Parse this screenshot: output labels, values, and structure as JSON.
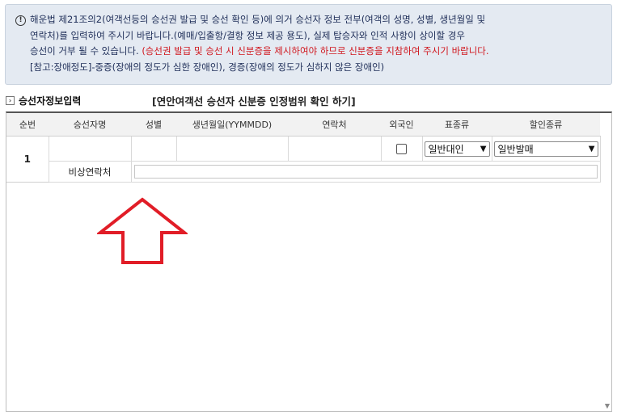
{
  "notice": {
    "line1": "해운법 제21조의2(여객선등의 승선권 발급 및 승선 확인 등)에 의거 승선자 정보 전부(여객의 성명, 성별, 생년월일 및",
    "line2": "연락처)를 입력하여 주시기 바랍니다.(예매/입출항/결항 정보 제공 용도), 실제 탑승자와 인적 사항이 상이할 경우",
    "line3_normal": "승선이 거부 될 수 있습니다. ",
    "line3_red": "(승선권 발급 및 승선 시 신분증을 제시하여야 하므로 신분증을 지참하여 주시기 바랍니다.",
    "line4": "[참고:장애정도]-중증(장애의 정도가 심한 장애인), 경증(장애의 정도가 심하지 않은 장애인)"
  },
  "section": {
    "title": "승선자정보입력",
    "id_link": "[연안여객선 승선자 신분증 인정범위 확인 하기]"
  },
  "table": {
    "headers": [
      "순번",
      "승선자명",
      "성별",
      "생년월일(YYMMDD)",
      "연락처",
      "외국인",
      "표종류",
      "할인종류"
    ],
    "row1": {
      "seq": "1",
      "name": "",
      "gender": "",
      "birth": "",
      "phone": "",
      "foreigner": false,
      "ticket_type": "일반대인",
      "discount_type": "일반발매",
      "emergency_label": "비상연락처",
      "emergency_value": ""
    }
  },
  "colors": {
    "notice_bg": "#e4eaf2",
    "notice_text": "#21305a",
    "warning_red": "#d0161d",
    "arrow_red": "#e11d27"
  },
  "icons": [
    "warning-icon",
    "section-arrow-icon",
    "chevron-down-icon",
    "up-arrow-annotation"
  ]
}
